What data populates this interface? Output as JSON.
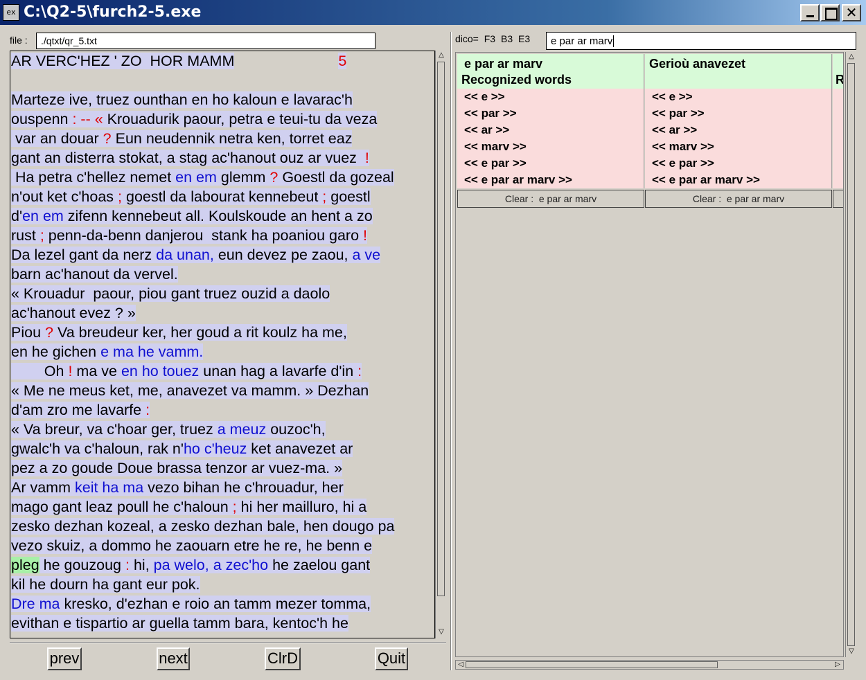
{
  "window": {
    "title": "C:\\Q2-5\\furch2-5.exe",
    "icon_label": "ex"
  },
  "file": {
    "label": "file :",
    "path": "./qtxt/qr_5.txt"
  },
  "text": {
    "header": "AR VERC'HEZ ' ZO  HOR MAMM",
    "chapter": "5",
    "lines": [
      [],
      [
        {
          "t": "Marteze ive, truez ounthan en ho kaloun e lavarac'h"
        }
      ],
      [
        {
          "t": "ouspenn "
        },
        {
          "t": ": -- «",
          "c": "r"
        },
        {
          "t": " Krouadurik paour, petra e teui-tu da veza"
        }
      ],
      [
        {
          "t": " var an douar "
        },
        {
          "t": "?",
          "c": "r"
        },
        {
          "t": " Eun neudennik netra ken, torret eaz"
        }
      ],
      [
        {
          "t": "gant an disterra stokat, a stag ac'hanout ouz ar vuez  "
        },
        {
          "t": "!",
          "c": "r"
        }
      ],
      [
        {
          "t": " Ha petra c'hellez nemet "
        },
        {
          "t": "en em",
          "c": "b"
        },
        {
          "t": " glemm "
        },
        {
          "t": "?",
          "c": "r"
        },
        {
          "t": " Goestl da gozeal"
        }
      ],
      [
        {
          "t": "n'out ket c'hoas "
        },
        {
          "t": ";",
          "c": "r"
        },
        {
          "t": " goestl da labourat kennebeut "
        },
        {
          "t": ";",
          "c": "r"
        },
        {
          "t": " goestl"
        }
      ],
      [
        {
          "t": "d'"
        },
        {
          "t": "en em",
          "c": "b"
        },
        {
          "t": " zifenn kennebeut all. Koulskoude an hent a zo"
        }
      ],
      [
        {
          "t": "rust "
        },
        {
          "t": ";",
          "c": "r"
        },
        {
          "t": " penn-da-benn danjerou  stank ha poaniou garo "
        },
        {
          "t": "!",
          "c": "r"
        }
      ],
      [
        {
          "t": "Da lezel gant da nerz "
        },
        {
          "t": "da unan,",
          "c": "b"
        },
        {
          "t": " eun devez pe zaou, "
        },
        {
          "t": "a ve",
          "c": "b"
        }
      ],
      [
        {
          "t": "barn ac'hanout da vervel."
        }
      ],
      [
        {
          "t": "« Krouadur  paour, piou gant truez ouzid a daolo"
        }
      ],
      [
        {
          "t": "ac'hanout evez ? »"
        }
      ],
      [
        {
          "t": "Piou "
        },
        {
          "t": "?",
          "c": "r"
        },
        {
          "t": " Va breudeur ker, her goud a rit koulz ha me,"
        }
      ],
      [
        {
          "t": "en he gichen "
        },
        {
          "t": "e ma he vamm.",
          "c": "b"
        }
      ],
      [
        {
          "t": "        Oh "
        },
        {
          "t": "!",
          "c": "r"
        },
        {
          "t": " ma ve "
        },
        {
          "t": "en ho touez",
          "c": "b"
        },
        {
          "t": " unan hag a lavarfe d'in "
        },
        {
          "t": ":",
          "c": "r"
        }
      ],
      [
        {
          "t": "« Me ne meus ket, me, anavezet va mamm. » Dezhan"
        }
      ],
      [
        {
          "t": "d'am zro me lavarfe "
        },
        {
          "t": ":",
          "c": "r"
        }
      ],
      [
        {
          "t": "« Va breur, va c'hoar ger, truez "
        },
        {
          "t": "a meuz",
          "c": "b"
        },
        {
          "t": " ouzoc'h,"
        }
      ],
      [
        {
          "t": "gwalc'h va c'haloun, rak n'"
        },
        {
          "t": "ho c'heuz",
          "c": "b"
        },
        {
          "t": " ket anavezet ar"
        }
      ],
      [
        {
          "t": "pez a zo goude Doue brassa tenzor ar vuez-ma. »"
        }
      ],
      [
        {
          "t": "Ar vamm "
        },
        {
          "t": "keit ha ma",
          "c": "b"
        },
        {
          "t": " vezo bihan he c'hrouadur, her"
        }
      ],
      [
        {
          "t": "mago gant leaz poull he c'haloun "
        },
        {
          "t": ";",
          "c": "r"
        },
        {
          "t": " hi her mailluro, hi a"
        }
      ],
      [
        {
          "t": "zesko dezhan kozeal, a zesko dezhan bale, hen dougo pa"
        }
      ],
      [
        {
          "t": "vezo skuiz, a dommo he zaouarn etre he re, he benn e"
        }
      ],
      [
        {
          "t": "pleg",
          "c": "g"
        },
        {
          "t": " he gouzoug "
        },
        {
          "t": ":",
          "c": "r"
        },
        {
          "t": " hi, "
        },
        {
          "t": "pa welo, a zec'ho",
          "c": "b"
        },
        {
          "t": " he zaelou gant"
        }
      ],
      [
        {
          "t": "kil he dourn ha gant eur pok."
        }
      ],
      [
        {
          "t": "Dre ma",
          "c": "b"
        },
        {
          "t": " kresko, d'ezhan e roio an tamm mezer tomma,"
        }
      ],
      [
        {
          "t": "evithan e tispartio ar guella tamm bara, kentoc'h he"
        }
      ]
    ]
  },
  "buttons": {
    "prev": "prev",
    "next": "next",
    "clrd": "ClrD",
    "quit": "Quit"
  },
  "dico": {
    "label": "dico= F3  B3  E3",
    "query": "e par ar marv"
  },
  "results": {
    "columns": [
      {
        "query": "e par ar marv",
        "title": "Recognized words",
        "rows": [
          "<< e >>",
          "<< par >>",
          "<< ar >>",
          "<< marv >>",
          "<< e par >>",
          "<< e par ar marv >>"
        ],
        "clear": "Clear :  e par ar marv"
      },
      {
        "query": "",
        "title": "Gerioù anavezet",
        "rows": [
          "<< e >>",
          "<< par >>",
          "<< ar >>",
          "<< marv >>",
          "<< e par >>",
          "<< e par ar marv >>"
        ],
        "clear": "Clear :  e par ar marv"
      }
    ],
    "third_column_partial": "R"
  },
  "colors": {
    "title_bar": "#0a246a",
    "text_highlight": "#d0d0f0",
    "red_mark": "#e00000",
    "blue_mark": "#1010d0",
    "green_mark": "#a8f0a8",
    "result_header": "#d8fad8",
    "result_row": "#fadcdc"
  }
}
